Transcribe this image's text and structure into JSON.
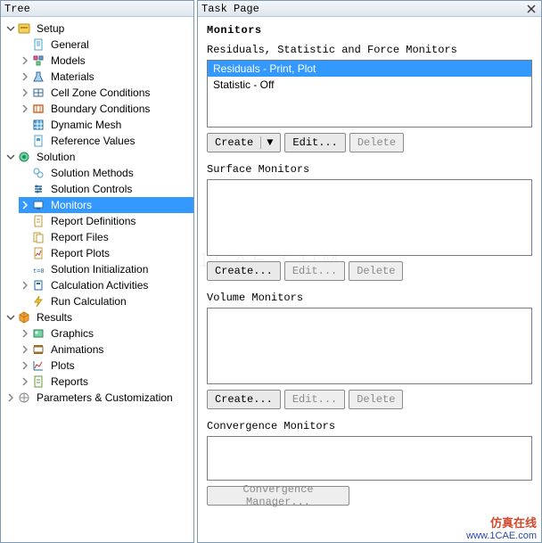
{
  "tree": {
    "header": "Tree",
    "setup": {
      "label": "Setup",
      "general": "General",
      "models": "Models",
      "materials": "Materials",
      "cell_zone": "Cell Zone Conditions",
      "boundary": "Boundary Conditions",
      "dynamic_mesh": "Dynamic Mesh",
      "reference_values": "Reference Values"
    },
    "solution": {
      "label": "Solution",
      "methods": "Solution Methods",
      "controls": "Solution Controls",
      "monitors": "Monitors",
      "report_def": "Report Definitions",
      "report_files": "Report Files",
      "report_plots": "Report Plots",
      "initialization": "Solution Initialization",
      "calc_activities": "Calculation Activities",
      "run_calc": "Run Calculation"
    },
    "results": {
      "label": "Results",
      "graphics": "Graphics",
      "animations": "Animations",
      "plots": "Plots",
      "reports": "Reports"
    },
    "parameters": "Parameters & Customization"
  },
  "task": {
    "header": "Task Page",
    "title": "Monitors",
    "sections": {
      "residuals_label": "Residuals, Statistic and Force Monitors",
      "surface_label": "Surface Monitors",
      "volume_label": "Volume Monitors",
      "conv_label": "Convergence Monitors"
    },
    "residuals_list": {
      "0": "Residuals - Print, Plot",
      "1": "Statistic - Off"
    },
    "buttons": {
      "create_dd": "Create",
      "create": "Create...",
      "edit": "Edit...",
      "delete": "Delete",
      "conv_mgr": "Convergence Manager..."
    }
  },
  "watermark": {
    "faint": "1CAE.COM",
    "cn": "仿真在线",
    "url": "www.1CAE.com"
  }
}
